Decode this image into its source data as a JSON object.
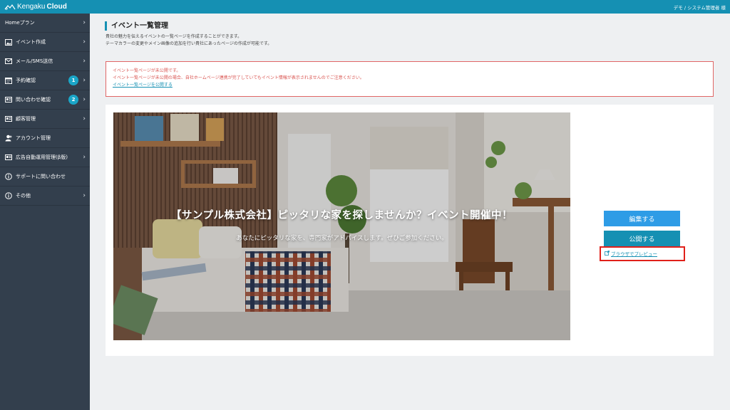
{
  "app": {
    "logo_prefix": "Kengaku",
    "logo_suffix": "Cloud",
    "user_label": "デモ / システム管理者 様",
    "colors": {
      "header": "#1590b3",
      "sidebar": "#333f4d",
      "badge": "#1aa6c8",
      "alert": "#d9534f"
    }
  },
  "sidebar": {
    "items": [
      {
        "label": "Homeプラン",
        "icon": "none",
        "chevron": true
      },
      {
        "label": "イベント作成",
        "icon": "image-icon",
        "chevron": true
      },
      {
        "label": "メール/SMS送信",
        "icon": "mail-icon",
        "chevron": true
      },
      {
        "label": "予約確認",
        "icon": "calendar-icon",
        "badge": "1",
        "chevron": true
      },
      {
        "label": "問い合わせ確認",
        "icon": "id-card-icon",
        "badge": "2",
        "chevron": true
      },
      {
        "label": "顧客管理",
        "icon": "id-card-icon",
        "chevron": true
      },
      {
        "label": "アカウント管理",
        "icon": "user-icon",
        "chevron": false
      },
      {
        "label": "広告自動運用管理(β版)",
        "icon": "id-card-icon",
        "chevron": true
      },
      {
        "label": "サポートに問い合わせ",
        "icon": "info-icon",
        "chevron": false
      },
      {
        "label": "その他",
        "icon": "info-icon",
        "chevron": true
      }
    ]
  },
  "main": {
    "title": "イベント一覧管理",
    "desc_line1": "貴社の魅力を伝えるイベントの一覧ページを作成することができます。",
    "desc_line2": "テーマカラーの変更やメイン画像の追加を行い貴社にあったページの作成が可能です。",
    "alert": {
      "line1": "イベント一覧ページが未公開です。",
      "line2": "イベント一覧ページが未公開の場合、自社ホームページ連携が完了していてもイベント情報が表示されませんのでご注意ください。",
      "link": "イベント一覧ページを公開する"
    },
    "hero": {
      "title": "【サンプル株式会社】ピッタリな家を探しませんか？イベント開催中！",
      "subtitle": "あなたにピッタリな家を、専門家がアドバイスします。ぜひご参加ください。"
    },
    "edit_label": "編集する",
    "publish_label": "公開する",
    "preview_label": "ブラウザでプレビュー"
  }
}
